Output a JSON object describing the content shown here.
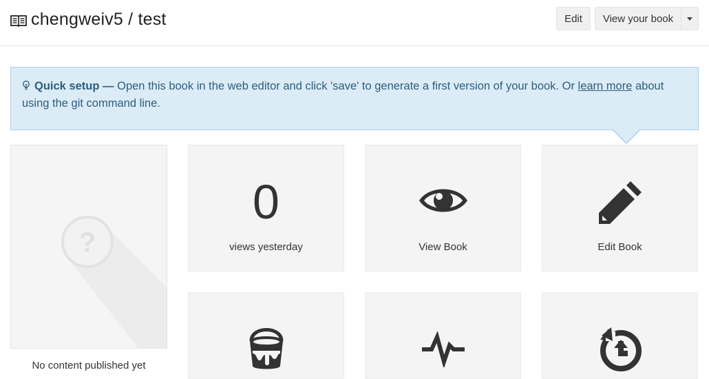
{
  "header": {
    "title": "chengweiv5 / test",
    "edit_label": "Edit",
    "view_label": "View your book"
  },
  "alert": {
    "heading": "Quick setup —",
    "text_before_link": " Open this book in the web editor and click 'save' to generate a first version of your book. Or ",
    "link": "learn more",
    "text_after_link": " about using the git command line."
  },
  "cover": {
    "caption": "No content published yet"
  },
  "tiles": [
    {
      "value": "0",
      "label": "views yesterday"
    },
    {
      "label": "View Book",
      "icon": "eye-icon"
    },
    {
      "label": "Edit Book",
      "icon": "pencil-icon"
    },
    {
      "icon": "paint-bucket-icon"
    },
    {
      "icon": "pulse-icon"
    },
    {
      "icon": "history-icon"
    }
  ]
}
